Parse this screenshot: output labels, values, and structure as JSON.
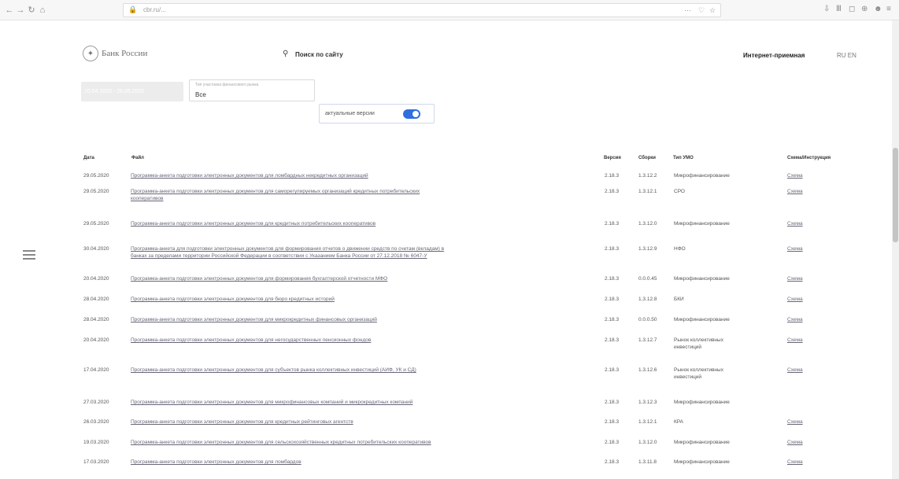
{
  "browser": {
    "url": "cbr.ru/...",
    "nav": [
      "←",
      "→",
      "↻",
      "⌂"
    ],
    "url_right": [
      "···",
      "♡",
      "☆"
    ],
    "toolbar_right": [
      "⇩",
      "Ⅲ",
      "◻",
      "⊕",
      "☻",
      "≡"
    ]
  },
  "header": {
    "brand": "Банк России",
    "search": "Поиск по сайту",
    "internet_reception": "Интернет-приемная",
    "lang": "RU EN"
  },
  "filters": {
    "date_range": "20.04.2020 - 26.05.2020",
    "type_caption": "Тип участника финансового рынка",
    "type_value": "Все",
    "toggle_label": "актуальные версии",
    "toggle_on": true
  },
  "table": {
    "headers": {
      "date": "Дата",
      "file": "Файл",
      "version": "Версия",
      "schema_ver": "Сборки",
      "type": "Тип УМО",
      "instr": "Схема/Инструкция"
    },
    "rows": [
      {
        "date": "29.05.2020",
        "file": [
          "Программа-анкета подготовки электронных документов для ломбардных некредитных организаций"
        ],
        "version": "2.18.3",
        "build": "1.3.12.2",
        "type": [
          "Микрофинансирование"
        ],
        "schema": "Схема"
      },
      {
        "date": "29.05.2020",
        "file": [
          "Программа-анкета подготовки электронных документов для саморегулируемых организаций кредитных потребительских",
          "кооперативов"
        ],
        "version": "2.18.3",
        "build": "1.3.12.1",
        "type": [
          "СРО"
        ],
        "schema": "Схема"
      },
      {
        "date": "29.05.2020",
        "file": [
          "Программа-анкета подготовки электронных документов для кредитных потребительских кооперативов"
        ],
        "version": "2.18.3",
        "build": "1.3.12.0",
        "type": [
          "Микрофинансирование"
        ],
        "schema": "Схема"
      },
      {
        "date": "30.04.2020",
        "file": [
          "Программа-анкета для подготовки электронных документов для формирования отчетов о движении средств по счетам (вкладам) в",
          "банках за пределами территории Российской Федерации в соответствии с Указанием Банка России от 27.12.2018 № 6047-У"
        ],
        "version": "2.18.3",
        "build": "1.3.12.9",
        "type": [
          "НФО"
        ],
        "schema": "Схема"
      },
      {
        "date": "20.04.2020",
        "file": [
          "Программа-анкета подготовки электронных документов для формирования бухгалтерской отчетности МФО"
        ],
        "version": "2.18.3",
        "build": "0.0.0.45",
        "type": [
          "Микрофинансирование"
        ],
        "schema": "Схема"
      },
      {
        "date": "28.04.2020",
        "file": [
          "Программа-анкета подготовки электронных документов для бюро кредитных историй"
        ],
        "version": "2.18.3",
        "build": "1.3.12.8",
        "type": [
          "БКИ"
        ],
        "schema": "Схема"
      },
      {
        "date": "28.04.2020",
        "file": [
          "Программа-анкета подготовки электронных документов для микрокредитных финансовых организаций"
        ],
        "version": "2.18.3",
        "build": "0.0.0.50",
        "type": [
          "Микрофинансирование"
        ],
        "schema": "Схема"
      },
      {
        "date": "20.04.2020",
        "file": [
          "Программа-анкета подготовки электронных документов для негосударственных пенсионных фондов"
        ],
        "version": "2.18.3",
        "build": "1.3.12.7",
        "type": [
          "Рынок коллективных",
          "инвестиций"
        ],
        "schema": "Схема"
      },
      {
        "date": "17.04.2020",
        "file": [
          "Программа-анкета подготовки электронных документов для субъектов рынка коллективных инвестиций (АИФ, УК и СД)"
        ],
        "version": "2.18.3",
        "build": "1.3.12.6",
        "type": [
          "Рынок коллективных",
          "инвестиций"
        ],
        "schema": "Схема"
      },
      {
        "date": "27.03.2020",
        "file": [
          "Программа-анкета подготовки электронных документов для микрофинансовых компаний и микрокредитных компаний"
        ],
        "version": "2.18.3",
        "build": "1.3.12.3",
        "type": [
          "Микрофинансирование"
        ],
        "schema": ""
      },
      {
        "date": "26.03.2020",
        "file": [
          "Программа-анкета подготовки электронных документов для кредитных рейтинговых агентств"
        ],
        "version": "2.18.3",
        "build": "1.3.12.1",
        "type": [
          "КРА"
        ],
        "schema": "Схема"
      },
      {
        "date": "19.03.2020",
        "file": [
          "Программа-анкета подготовки электронных документов для сельскохозяйственных кредитных потребительских кооперативов"
        ],
        "version": "2.18.3",
        "build": "1.3.12.0",
        "type": [
          "Микрофинансирование"
        ],
        "schema": "Схема"
      },
      {
        "date": "17.03.2020",
        "file": [
          "Программа-анкета подготовки электронных документов для ломбардов"
        ],
        "version": "2.18.3",
        "build": "1.3.11.8",
        "type": [
          "Микрофинансирование"
        ],
        "schema": "Схема"
      }
    ]
  },
  "colors": {
    "toggle": "#2f6fe0",
    "link": "#667"
  }
}
